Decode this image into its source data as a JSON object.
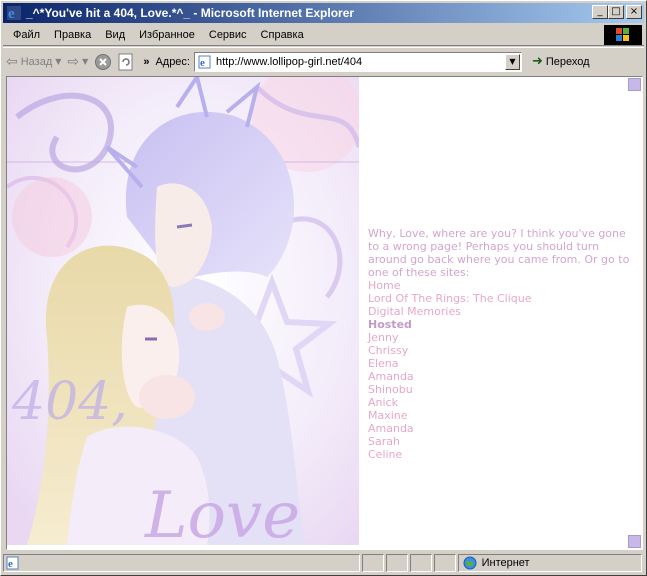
{
  "window": {
    "title": "_^*You've hit a 404, Love.*^_ - Microsoft Internet Explorer",
    "minimize_glyph": "_",
    "maximize_glyph": "□",
    "close_glyph": "×"
  },
  "menu": {
    "items": [
      {
        "label": "Файл"
      },
      {
        "label": "Правка"
      },
      {
        "label": "Вид"
      },
      {
        "label": "Избранное"
      },
      {
        "label": "Сервис"
      },
      {
        "label": "Справка"
      }
    ]
  },
  "toolbar": {
    "back_label": "Назад",
    "more_glyph": "»",
    "address_label": "Адрес:",
    "address_value": "http://www.lollipop-girl.net/404",
    "go_label": "Переход"
  },
  "page": {
    "art_text": "404, Love",
    "intro": "Why, Love, where are you? I think you've gone to a wrong page! Perhaps you should turn around go back where you came from. Or go to one of these sites:",
    "links": [
      {
        "label": "Home"
      },
      {
        "label": "Lord Of The Rings: The Clique"
      },
      {
        "label": "Digital Memories"
      }
    ],
    "hosted_label": "Hosted",
    "hosted": [
      {
        "label": "Jenny"
      },
      {
        "label": "Chrissy"
      },
      {
        "label": "Elena"
      },
      {
        "label": "Amanda"
      },
      {
        "label": "Shinobu"
      },
      {
        "label": "Anick"
      },
      {
        "label": "Maxine"
      },
      {
        "label": "Amanda"
      },
      {
        "label": "Sarah"
      },
      {
        "label": "Celine"
      }
    ]
  },
  "status": {
    "zone_label": "Интернет"
  },
  "colors": {
    "title_gradient_start": "#0a246a",
    "title_gradient_end": "#a6caf0",
    "link_pink": "#e6a8c8",
    "intro_lilac": "#d2a6cc",
    "art_lavender": "#b8a8e0"
  }
}
